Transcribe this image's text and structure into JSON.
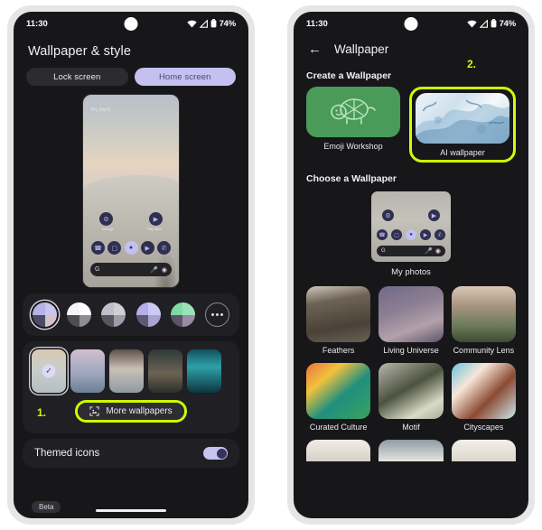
{
  "meta": {
    "accent_highlight": "#ccff00",
    "screen_bg": "#17171a",
    "frame": "#e6e6e6"
  },
  "status_bar": {
    "time": "11:30",
    "battery_pct": "74%",
    "wifi_icon": "wifi-icon",
    "signal_icon": "signal-icon",
    "battery_icon": "battery-icon"
  },
  "left_phone": {
    "title": "Wallpaper & style",
    "segments": [
      {
        "label": "Lock screen",
        "selected": false
      },
      {
        "label": "Home screen",
        "selected": true
      }
    ],
    "preview": {
      "date": "Fri, Oct 6",
      "app_labels": [
        "Settings",
        "Play Movi"
      ],
      "dock_icons": [
        "whatsapp-icon",
        "instagram-icon",
        "messages-icon",
        "youtube-icon",
        "phone-icon"
      ],
      "search_left_icon": "google-g-icon",
      "search_mic_icon": "microphone-icon",
      "search_lens_icon": "lens-icon"
    },
    "color_swatches": [
      {
        "name": "swatch-1",
        "selected": true,
        "colors": [
          "#b6b2e8",
          "#c9c5ef",
          "#4e4a63",
          "#d6c0cc"
        ]
      },
      {
        "name": "swatch-2",
        "selected": false,
        "colors": [
          "#f4f4f4",
          "#ffffff",
          "#4e4e52",
          "#8d8d92"
        ]
      },
      {
        "name": "swatch-3",
        "selected": false,
        "colors": [
          "#c0bec9",
          "#cfcdd6",
          "#56545c",
          "#9e9ca6"
        ]
      },
      {
        "name": "swatch-4",
        "selected": false,
        "colors": [
          "#b4afeb",
          "#cdc9f4",
          "#5d5976",
          "#a9a3d4"
        ]
      },
      {
        "name": "swatch-5",
        "selected": false,
        "colors": [
          "#7ed9a2",
          "#9be2b6",
          "#5b5568",
          "#9a8aa6"
        ]
      },
      {
        "name": "swatch-more",
        "selected": false,
        "more": true
      }
    ],
    "wallpaper_thumbs": [
      {
        "name": "thumb-selected",
        "selected": true,
        "grad": "linear-gradient(180deg,#d9c9b2 0%,#c9cdcb 45%,#b6bfc2 100%)"
      },
      {
        "name": "thumb-city",
        "selected": false,
        "grad": "linear-gradient(180deg,#d3bfd0 0%,#9fa7bd 55%,#6d7f95 100%)"
      },
      {
        "name": "thumb-mountain",
        "selected": false,
        "grad": "linear-gradient(180deg,#5d5049 0%,#c8c0b5 45%,#8f9aa3 100%)"
      },
      {
        "name": "thumb-road",
        "selected": false,
        "grad": "linear-gradient(180deg,#2e3a3a 0%,#6d6352 55%,#2b2e2c 100%)"
      },
      {
        "name": "thumb-teal",
        "selected": false,
        "grad": "linear-gradient(180deg,#12505c 0%,#2ea0a8 40%,#0d3640 100%)"
      }
    ],
    "more_wallpapers": {
      "label": "More wallpapers",
      "icon": "image-frame-icon"
    },
    "annotation_1": "1.",
    "themed_icons": {
      "label": "Themed icons",
      "toggle_on": true
    },
    "beta_badge": "Beta"
  },
  "right_phone": {
    "back_icon": "back-arrow-icon",
    "title": "Wallpaper",
    "annotation_2": "2.",
    "create_section": {
      "heading": "Create a Wallpaper",
      "items": [
        {
          "label": "Emoji Workshop",
          "art": "turtle-icon",
          "highlighted": false
        },
        {
          "label": "AI wallpaper",
          "art": "ai-art",
          "highlighted": true
        }
      ]
    },
    "choose_section": {
      "heading": "Choose a Wallpaper",
      "my_photos_label": "My photos",
      "categories": [
        {
          "label": "Feathers",
          "grad": "linear-gradient(170deg,#cfc8bd 0%,#6d6355 28%,#4a4238 70%,#6a6152 100%)"
        },
        {
          "label": "Living Universe",
          "grad": "linear-gradient(160deg,#6f6a86 0%,#8d7f93 40%,#b3a1ab 70%,#5d5569 100%)"
        },
        {
          "label": "Community Lens",
          "grad": "linear-gradient(180deg,#d9c7b6 0%,#a89480 35%,#6d7b5c 70%,#3f4a35 100%)"
        },
        {
          "label": "Curated Culture",
          "grad": "linear-gradient(140deg,#e8713f 0%,#f2c23c 28%,#1f8f7e 58%,#3aa35e 100%)"
        },
        {
          "label": "Motif",
          "grad": "linear-gradient(150deg,#b9b7ab 0%,#4c5240 45%,#d9dcc6 78%,#a9a89a 100%)"
        },
        {
          "label": "Cityscapes",
          "grad": "linear-gradient(135deg,#6fc2e0 0%,#f7e6d8 30%,#8a4a33 62%,#cfe6ef 100%)"
        }
      ],
      "partial_row": [
        {
          "grad": "linear-gradient(180deg,#f0ece6 0%,#d8cfc6 100%)"
        },
        {
          "grad": "linear-gradient(180deg,#8f9aa3 0%,#e3e5e0 100%)"
        },
        {
          "grad": "linear-gradient(180deg,#f2efe9 0%,#ddd6cc 100%)"
        }
      ]
    }
  }
}
